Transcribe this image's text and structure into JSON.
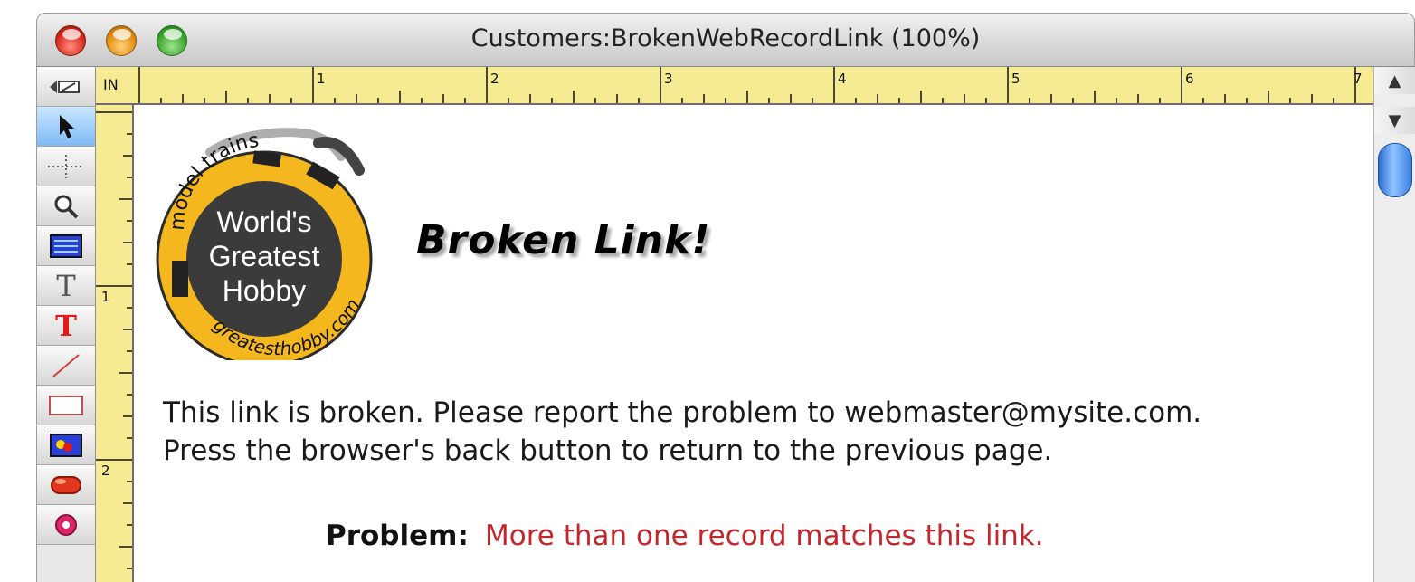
{
  "window": {
    "title": "Customers:BrokenWebRecordLink (100%)"
  },
  "ruler": {
    "units_label": "IN",
    "top_numbers": [
      "1",
      "2",
      "3",
      "4",
      "5",
      "6",
      "7"
    ],
    "left_numbers": [
      "1",
      "2"
    ]
  },
  "palette": {
    "tools": [
      "pointer-tool",
      "guide-tool",
      "magnify-tool",
      "data-cell-tool",
      "text-tool",
      "formula-text-tool",
      "line-tool",
      "rectangle-tool",
      "picture-tool",
      "button-tool",
      "radio-button-tool"
    ]
  },
  "logo": {
    "arc_top": "model trains",
    "line1": "World's",
    "line2": "Greatest",
    "line3": "Hobby",
    "arc_bottom": "greatesthobby.com"
  },
  "content": {
    "heading": "Broken Link!",
    "message_line1": "This link is broken. Please report the problem to webmaster@mysite.com.",
    "message_line2": "Press the browser's back button to return to the previous page.",
    "problem_label": "Problem:",
    "problem_text": "More than one record matches this link."
  },
  "colors": {
    "ruler": "#f6ea93",
    "problem_text": "#c3262c",
    "logo_ring": "#f4b81e",
    "logo_center": "#3b3b3b"
  }
}
